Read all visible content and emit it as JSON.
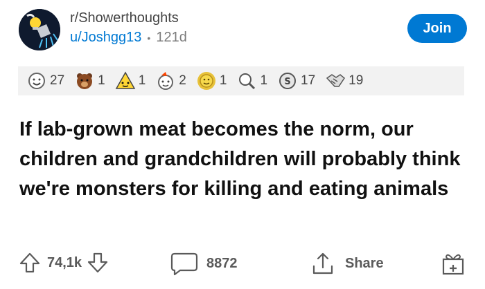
{
  "header": {
    "subreddit": "r/Showerthoughts",
    "username": "u/Joshgg13",
    "age": "121d",
    "join_label": "Join"
  },
  "awards": [
    {
      "icon": "smiley-award-icon",
      "count": "27"
    },
    {
      "icon": "bear-award-icon",
      "count": "1"
    },
    {
      "icon": "warning-award-icon",
      "count": "1"
    },
    {
      "icon": "party-award-icon",
      "count": "2"
    },
    {
      "icon": "gold-award-icon",
      "count": "1"
    },
    {
      "icon": "magnifier-award-icon",
      "count": "1"
    },
    {
      "icon": "silver-award-icon",
      "count": "17"
    },
    {
      "icon": "handshake-award-icon",
      "count": "19"
    }
  ],
  "post": {
    "title": "If lab-grown meat becomes the norm, our children and grandchildren will probably think we're monsters for killing and eating animals"
  },
  "footer": {
    "upvotes": "74,1k",
    "comments": "8872",
    "share_label": "Share"
  },
  "colors": {
    "accent": "#0079d3",
    "award_bar_bg": "#f2f2f2",
    "avatar_bg": "#0f1a2e"
  }
}
